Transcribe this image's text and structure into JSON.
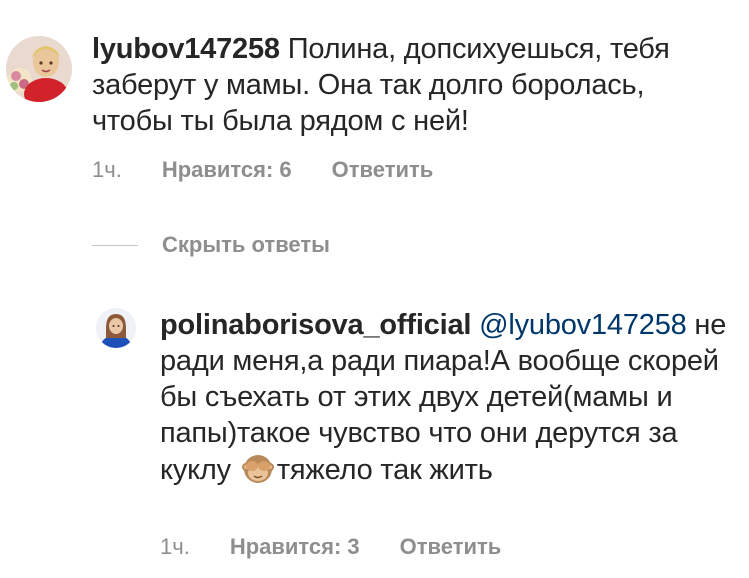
{
  "comments": [
    {
      "username": "lyubov147258",
      "text": "Полина, допсихуешься, тебя заберут у мамы. Она так долго боролась, чтобы ты была рядом с ней!",
      "time": "1ч.",
      "likes": "Нравится: 6",
      "reply_label": "Ответить",
      "avatar_icon": "avatar-woman-flowers"
    }
  ],
  "hide_replies_label": "Скрыть ответы",
  "replies": [
    {
      "username": "polinaborisova_official",
      "mention": "@lyubov147258",
      "text_before_emoji": "не ради меня,а ради пиара!А вообще скорей бы съехать от этих двух детей(мамы и папы)такое чувство что они дерутся за куклу",
      "emoji": "see-no-evil-monkey",
      "text_after_emoji": "тяжело так жить",
      "time": "1ч.",
      "likes": "Нравится: 3",
      "reply_label": "Ответить",
      "avatar_icon": "avatar-girl-blue"
    }
  ],
  "colors": {
    "text": "#262626",
    "meta": "#8e8e8e",
    "mention": "#00376b"
  }
}
